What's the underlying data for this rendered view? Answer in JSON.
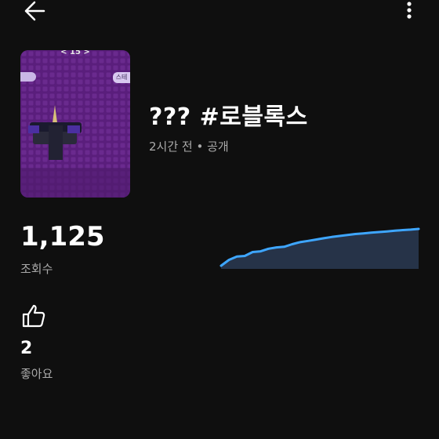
{
  "header": {
    "back_icon": "arrow-left-icon",
    "more_icon": "more-vert-icon"
  },
  "video": {
    "thumbnail_top_text": "< 15 >",
    "thumbnail_badge_text": "스테",
    "title": "??? #로블록스",
    "meta": "2시간 전 • 공개"
  },
  "stats": {
    "views_value": "1,125",
    "views_label": "조회수",
    "likes_value": "2",
    "likes_label": "좋아요",
    "like_icon": "thumbs-up-icon"
  },
  "colors": {
    "background": "#0f0f0f",
    "accent_line": "#3ea6ff",
    "area_fill": "#263348",
    "thumbnail_bg": "#5c1f7f"
  },
  "chart_data": {
    "type": "area",
    "title": "",
    "xlabel": "",
    "ylabel": "",
    "x": [
      0,
      1,
      2,
      3,
      4,
      5,
      6,
      7,
      8,
      9,
      10,
      11,
      12,
      13,
      14,
      15,
      16,
      17,
      18,
      19,
      20,
      21,
      22,
      23,
      24,
      25
    ],
    "values": [
      0,
      180,
      280,
      300,
      420,
      440,
      520,
      560,
      580,
      660,
      720,
      760,
      800,
      840,
      880,
      910,
      940,
      970,
      990,
      1010,
      1030,
      1050,
      1070,
      1090,
      1105,
      1125
    ],
    "ylim": [
      0,
      1150
    ],
    "grid": false,
    "legend": "none"
  }
}
